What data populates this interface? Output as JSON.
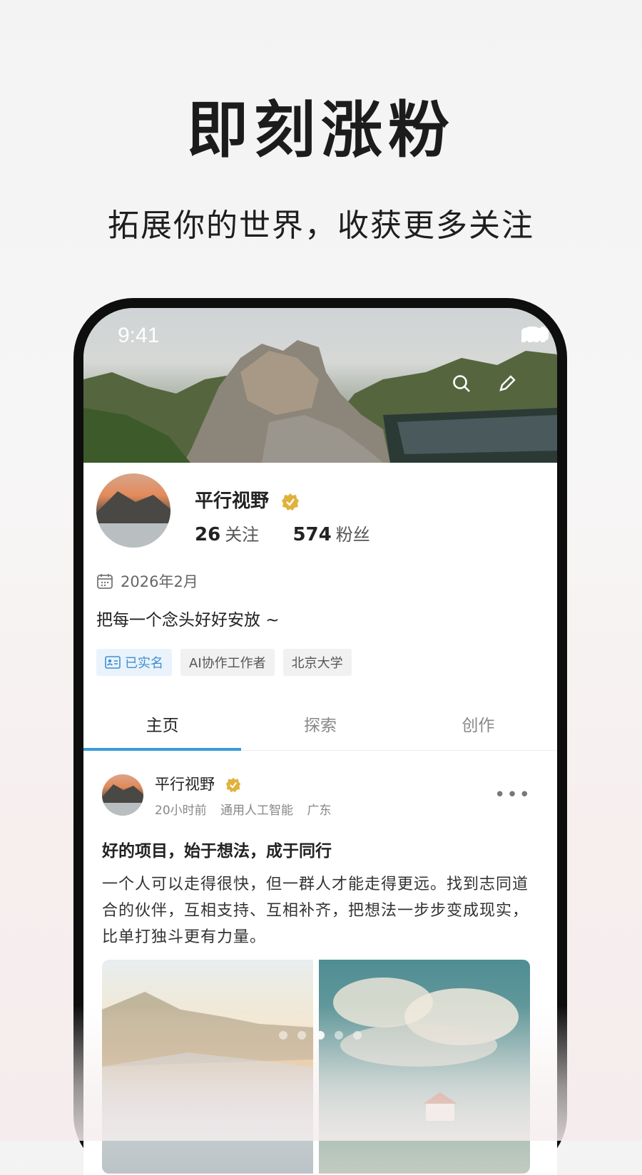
{
  "headline": "即刻涨粉",
  "subline": "拓展你的世界，收获更多关注",
  "status_bar": {
    "time": "9:41"
  },
  "profile": {
    "name": "平行视野",
    "following_count": "26",
    "following_label": "关注",
    "followers_count": "574",
    "followers_label": "粉丝",
    "joined": "2026年2月",
    "bio": "把每一个念头好好安放 ~",
    "tags": [
      "已实名",
      "AI协作工作者",
      "北京大学"
    ]
  },
  "tabs": [
    "主页",
    "探索",
    "创作"
  ],
  "active_tab": "主页",
  "post": {
    "author": "平行视野",
    "time": "20小时前",
    "topic": "通用人工智能",
    "location": "广东",
    "title": "好的项目，始于想法，成于同行",
    "body": "一个人可以走得很快，但一群人才能走得更远。找到志同道合的伙伴，互相支持、互相补齐，把想法一步步变成现实，比单打独斗更有力量。"
  },
  "carousel": {
    "count": 5,
    "active_index": 2
  },
  "colors": {
    "accent": "#3a9bd8",
    "verified_gold": "#e0b23c",
    "realname_blue": "#3d8fd4"
  }
}
